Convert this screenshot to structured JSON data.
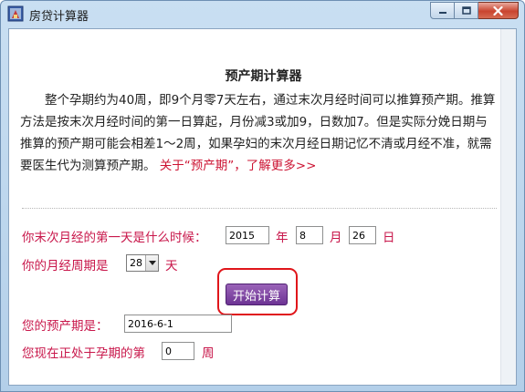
{
  "window": {
    "title": "房贷计算器"
  },
  "content": {
    "heading": "预产期计算器",
    "intro_text": "整个孕期约为40周，即9个月零7天左右，通过末次月经时间可以推算预产期。推算方法是按末次月经时间的第一日算起，月份减3或加9，日数加7。但是实际分娩日期与推算的预产期可能会相差1～2周，如果孕妇的末次月经日期记忆不清或月经不准，就需要医生代为测算预产期。",
    "intro_link": "关于“预产期”，了解更多>>"
  },
  "form": {
    "last_period_label": "你末次月经的第一天是什么时候：",
    "year_value": "2015",
    "year_unit": "年",
    "month_value": "8",
    "month_unit": "月",
    "day_value": "26",
    "day_unit": "日",
    "cycle_label": "你的月经周期是",
    "cycle_value": "28",
    "cycle_unit": "天",
    "start_button": "开始计算",
    "due_date_label": "您的预产期是：",
    "due_date_value": "2016-6-1",
    "week_label": "您现在正处于孕期的第",
    "week_value": "0",
    "week_unit": "周"
  },
  "icons": {
    "app": "app-icon",
    "minimize": "minimize-icon",
    "maximize": "maximize-icon",
    "close": "close-icon",
    "dropdown": "chevron-down-icon"
  },
  "colors": {
    "accent_text": "#c8164a",
    "link": "#cc1433",
    "button": "#7a3fa0",
    "highlight_ring": "#e0151a"
  }
}
